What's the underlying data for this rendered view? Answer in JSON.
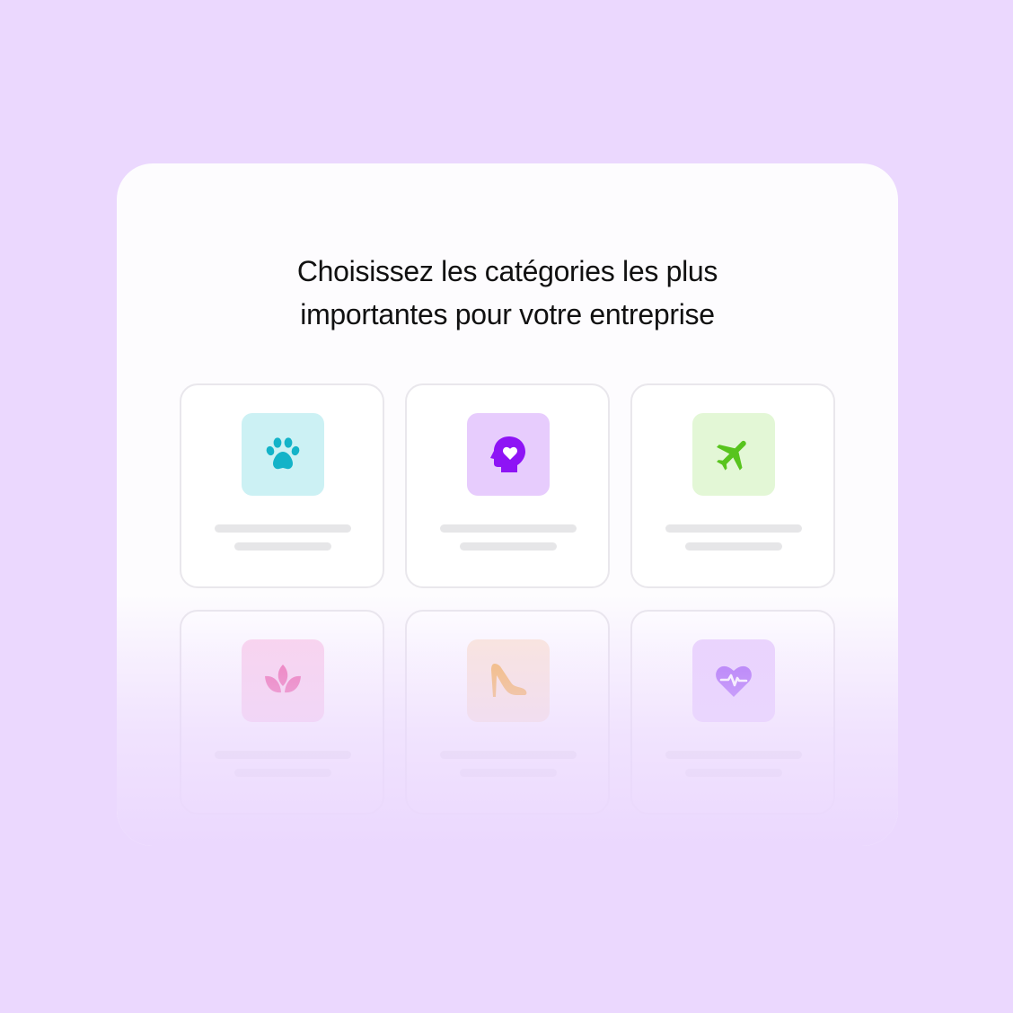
{
  "heading": {
    "line1": "Choisissez les catégories les plus",
    "line2": "importantes pour votre entreprise"
  },
  "categories": [
    {
      "icon": "paw-icon",
      "tile_color": "#ccf1f4",
      "icon_color": "#13b3c8"
    },
    {
      "icon": "head-heart-icon",
      "tile_color": "#e7ccfd",
      "icon_color": "#8e14f5"
    },
    {
      "icon": "airplane-icon",
      "tile_color": "#e3f7d6",
      "icon_color": "#58c41e"
    },
    {
      "icon": "lotus-icon",
      "tile_color": "#fcd3ea",
      "icon_color": "#ef5aa3"
    },
    {
      "icon": "high-heel-icon",
      "tile_color": "#fde8d6",
      "icon_color": "#f7b04a"
    },
    {
      "icon": "heart-pulse-icon",
      "tile_color": "#e9d2fd",
      "icon_color": "#a05af5"
    }
  ],
  "colors": {
    "background": "#ebd8fe",
    "panel": "#fdfcfe",
    "card_border": "#e9e7ec",
    "placeholder_line": "#e6e6e8"
  }
}
